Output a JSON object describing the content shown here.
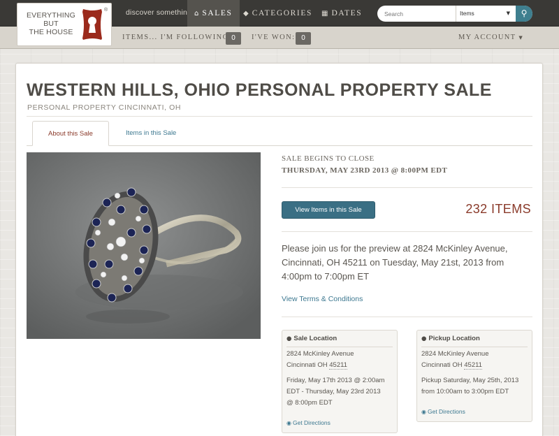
{
  "brand": {
    "logo_lines": [
      "EVERYTHING",
      "BUT",
      "THE HOUSE"
    ],
    "registered": "®",
    "tagline": "discover something",
    "brand_color": "#9b2a1c"
  },
  "nav": {
    "items": [
      {
        "label": "SALES",
        "icon": "home-icon",
        "active": true
      },
      {
        "label": "CATEGORIES",
        "icon": "tag-icon",
        "active": false
      },
      {
        "label": "DATES",
        "icon": "calendar-icon",
        "active": false
      }
    ]
  },
  "search": {
    "placeholder": "Search",
    "scope_selected": "Items"
  },
  "subnav": {
    "following_label": "ITEMS... I'M FOLLOWING:",
    "following_count": "0",
    "won_label": "I'VE WON:",
    "won_count": "0",
    "account_label": "MY ACCOUNT"
  },
  "sale": {
    "title": "WESTERN HILLS, OHIO PERSONAL PROPERTY SALE",
    "subtitle": "PERSONAL PROPERTY CINCINNATI, OH",
    "tabs": [
      {
        "label": "About this Sale",
        "active": true
      },
      {
        "label": "Items in this Sale",
        "active": false
      }
    ],
    "close_label": "SALE BEGINS TO CLOSE",
    "close_date": "THURSDAY, MAY 23RD 2013 @ 8:00PM EDT",
    "view_button": "View Items in this Sale",
    "item_count": "232 ITEMS",
    "preview_text": "Please join us for the preview at 2824 McKinley Avenue, Cincinnati, OH 45211 on Tuesday, May 21st, 2013 from 4:00pm to 7:00pm ET",
    "terms_link": "View Terms & Conditions"
  },
  "sale_location": {
    "heading": "Sale Location",
    "address1": "2824 McKinley Avenue",
    "city": "Cincinnati OH ",
    "zip": "45211",
    "time_lines": [
      "Friday, May 17th 2013 @ 2:00am",
      "EDT - Thursday, May 23rd 2013",
      "@ 8:00pm EDT"
    ],
    "directions": "Get Directions"
  },
  "pickup_location": {
    "heading": "Pickup Location",
    "address1": "2824 McKinley Avenue",
    "city": "Cincinnati OH ",
    "zip": "45211",
    "time_lines": [
      "Pickup Saturday, May 25th, 2013",
      "from 10:00am to 3:00pm EDT"
    ],
    "directions": "Get Directions"
  },
  "colors": {
    "accent_link": "#3d7890",
    "accent_red": "#8a3a2a",
    "button": "#3a6f84",
    "topbar": "#3a3936"
  }
}
